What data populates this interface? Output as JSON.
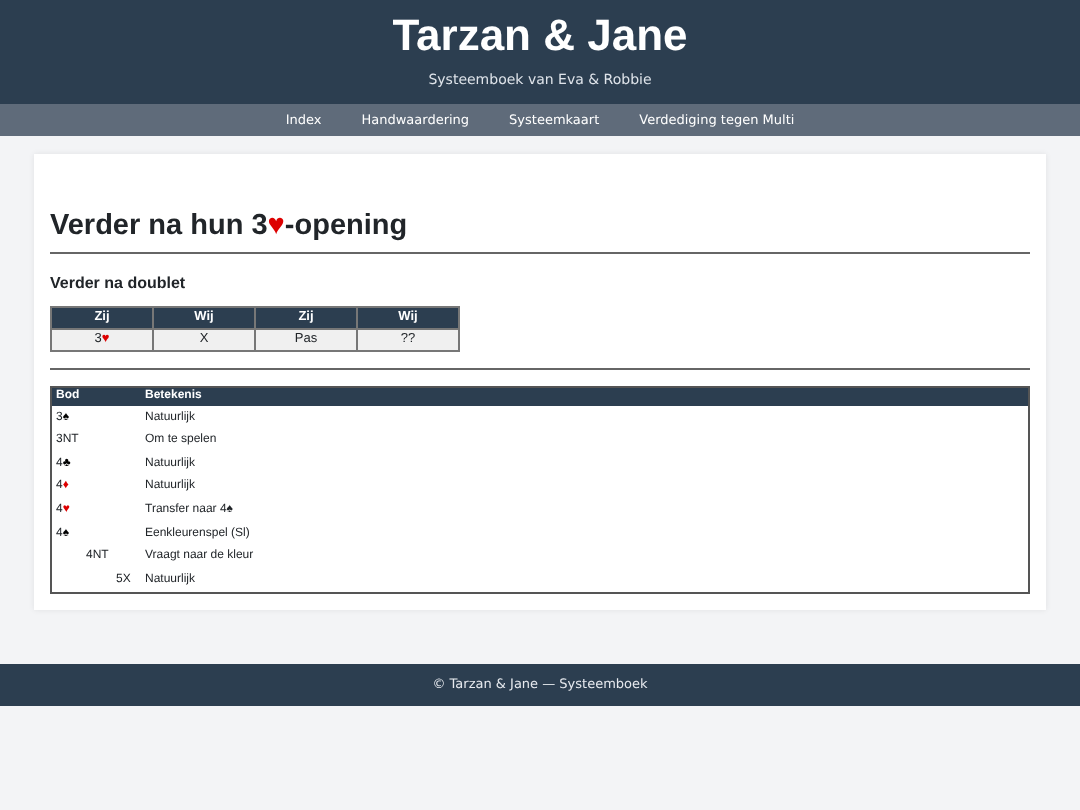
{
  "header": {
    "title": "Tarzan & Jane",
    "subtitle": "Systeemboek van Eva & Robbie"
  },
  "nav": [
    {
      "label": "Index"
    },
    {
      "label": "Handwaardering"
    },
    {
      "label": "Systeemkaart"
    },
    {
      "label": "Verdediging tegen Multi"
    }
  ],
  "heading": {
    "before": "Verder na hun 3",
    "suit": "♥",
    "color": "#dd0000",
    "after": "-opening"
  },
  "section": {
    "title": "Verder na doublet",
    "auction": {
      "columns": [
        "Zij",
        "Wij",
        "Zij",
        "Wij"
      ],
      "cells": [
        {
          "text": "3",
          "suit": "♥",
          "color": "#dd0000"
        },
        {
          "text": "X"
        },
        {
          "text": "Pas"
        },
        {
          "text": "??"
        }
      ]
    },
    "bids": {
      "columns": [
        "Bod",
        "Betekenis"
      ],
      "rows": [
        {
          "bid": {
            "text": "3",
            "suit": "♠",
            "color": "#000000"
          },
          "meaning": "Natuurlijk"
        },
        {
          "bid": {
            "text": "3NT"
          },
          "meaning": "Om te spelen"
        },
        {
          "bid": {
            "text": "4",
            "suit": "♣",
            "color": "#000000"
          },
          "meaning": "Natuurlijk"
        },
        {
          "bid": {
            "text": "4",
            "suit": "♦",
            "color": "#dd0000"
          },
          "meaning": "Natuurlijk"
        },
        {
          "bid": {
            "text": "4",
            "suit": "♥",
            "color": "#dd0000"
          },
          "meaning": "Transfer naar 4♠"
        },
        {
          "bid": {
            "text": "4",
            "suit": "♠",
            "color": "#000000"
          },
          "meaning": "Eenkleurenspel (Sl)",
          "children": [
            {
              "bid": {
                "text": "4NT"
              },
              "meaning": "Vraagt naar de kleur",
              "children": [
                {
                  "bid": {
                    "text": "5X"
                  },
                  "meaning": "Natuurlijk"
                }
              ]
            }
          ]
        }
      ]
    }
  },
  "footer": "© Tarzan & Jane — Systeemboek"
}
